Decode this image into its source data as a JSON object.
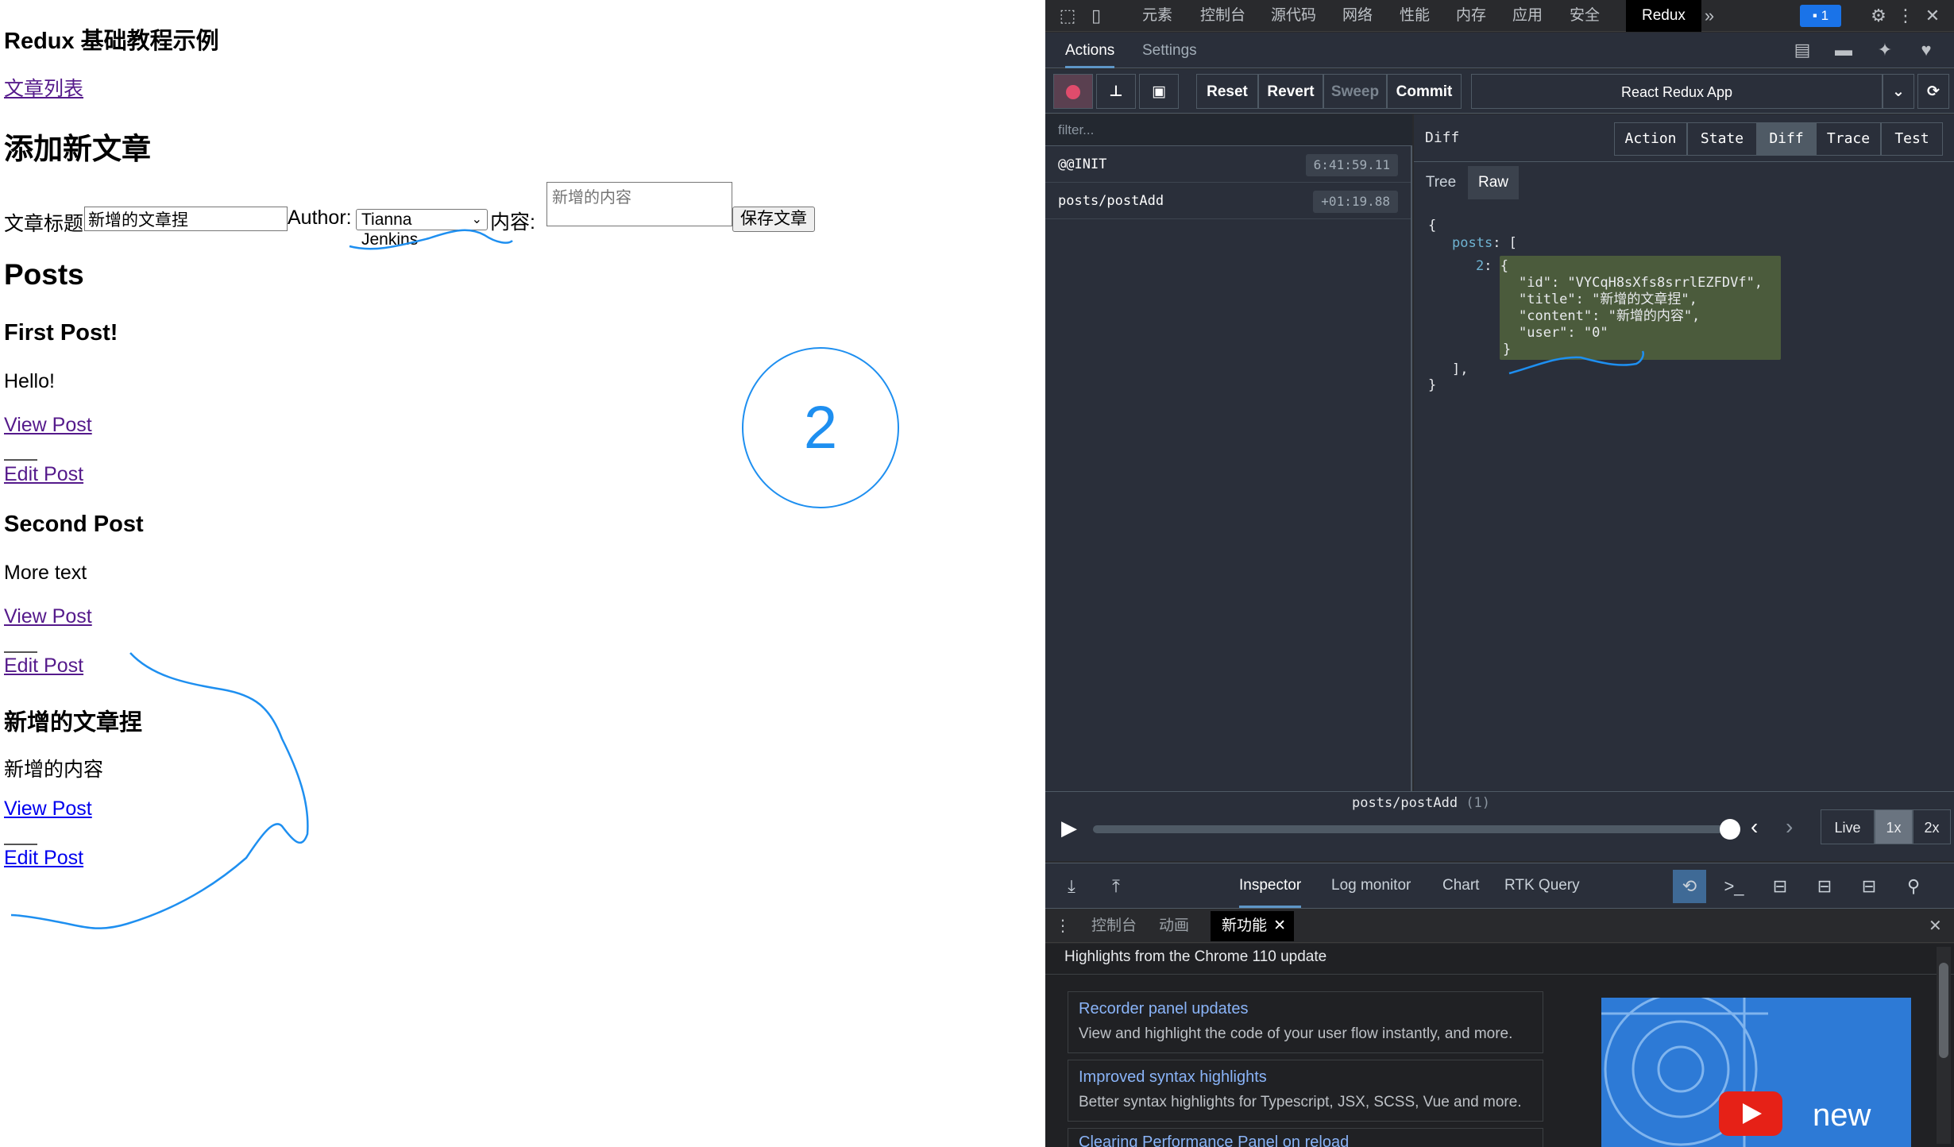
{
  "page": {
    "title": "Redux 基础教程示例",
    "nav_link": "文章列表",
    "add_heading": "添加新文章",
    "form": {
      "title_label": "文章标题:",
      "title_value": "新增的文章捏",
      "author_label": "Author:",
      "author_value": "Tianna Jenkins",
      "content_label": "内容:",
      "content_placeholder": "新增的内容",
      "save_button": "保存文章"
    },
    "posts_heading": "Posts",
    "posts": [
      {
        "title": "First Post!",
        "content": "Hello!",
        "view": "View Post",
        "edit": "Edit Post"
      },
      {
        "title": "Second Post",
        "content": "More text",
        "view": "View Post",
        "edit": "Edit Post"
      },
      {
        "title": "新增的文章捏",
        "content": "新增的内容",
        "view": "View Post",
        "edit": "Edit Post"
      }
    ],
    "annotation_number": "2"
  },
  "devtools": {
    "tabs": [
      "元素",
      "控制台",
      "源代码",
      "网络",
      "性能",
      "内存",
      "应用",
      "安全"
    ],
    "active_tab": "Redux",
    "issues_count": "1",
    "redux": {
      "tabs": [
        "Actions",
        "Settings"
      ],
      "toolbar": {
        "reset": "Reset",
        "revert": "Revert",
        "sweep": "Sweep",
        "commit": "Commit",
        "instance": "React Redux App"
      },
      "filter_placeholder": "filter...",
      "actions": [
        {
          "name": "@@INIT",
          "time": "6:41:59.11"
        },
        {
          "name": "posts/postAdd",
          "time": "+01:19.88"
        }
      ],
      "panel_title": "Diff",
      "view_tabs": [
        "Action",
        "State",
        "Diff",
        "Trace",
        "Test"
      ],
      "sub_tabs": [
        "Tree",
        "Raw"
      ],
      "diff": {
        "open_brace": "{",
        "posts_key": "posts",
        "posts_open": ": [",
        "index_key": "2",
        "index_open": ": {",
        "id_line": "\"id\": \"VYCqH8sXfs8srrlEZFDVf\",",
        "title_line": "\"title\": \"新增的文章捏\",",
        "content_line": "\"content\": \"新增的内容\",",
        "user_line": "\"user\": \"0\"",
        "close_obj": "}",
        "close_arr": "],",
        "close_brace": "}"
      },
      "slider": {
        "label": "posts/postAdd",
        "count": "(1)",
        "live": "Live",
        "speed1": "1x",
        "speed2": "2x"
      },
      "monitors": [
        "Inspector",
        "Log monitor",
        "Chart",
        "RTK Query"
      ]
    },
    "drawer": {
      "tabs": [
        "控制台",
        "动画",
        "新功能"
      ],
      "headline": "Highlights from the Chrome 110 update",
      "cards": [
        {
          "title": "Recorder panel updates",
          "desc": "View and highlight the code of your user flow instantly, and more."
        },
        {
          "title": "Improved syntax highlights",
          "desc": "Better syntax highlights for Typescript, JSX, SCSS, Vue and more."
        },
        {
          "title": "Clearing Performance Panel on reload",
          "desc": ""
        }
      ],
      "video_caption": "new"
    }
  }
}
